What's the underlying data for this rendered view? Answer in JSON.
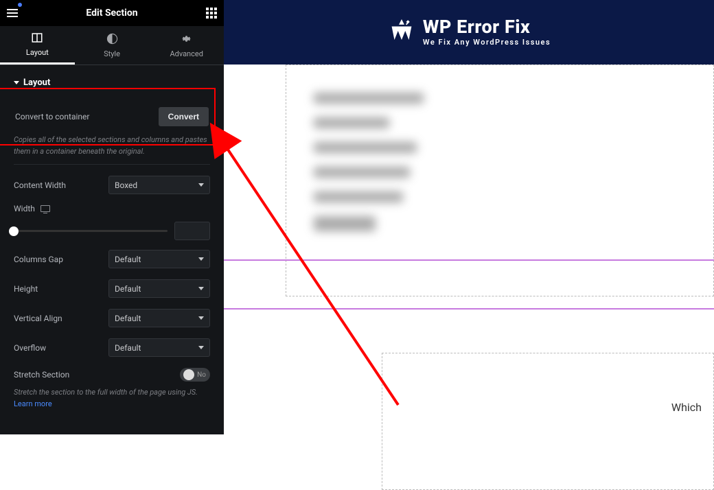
{
  "header": {
    "title": "Edit Section"
  },
  "tabs": {
    "layout": "Layout",
    "style": "Style",
    "advanced": "Advanced"
  },
  "section_title": "Layout",
  "convert": {
    "label": "Convert to container",
    "button": "Convert",
    "help": "Copies all of the selected sections and columns and pastes them in a container beneath the original."
  },
  "content_width": {
    "label": "Content Width",
    "value": "Boxed"
  },
  "width": {
    "label": "Width"
  },
  "columns_gap": {
    "label": "Columns Gap",
    "value": "Default"
  },
  "height": {
    "label": "Height",
    "value": "Default"
  },
  "vertical_align": {
    "label": "Vertical Align",
    "value": "Default"
  },
  "overflow": {
    "label": "Overflow",
    "value": "Default"
  },
  "stretch": {
    "label": "Stretch Section",
    "toggle": "No",
    "help": "Stretch the section to the full width of the page using JS.",
    "link": "Learn more"
  },
  "brand": {
    "name": "WP Error Fix",
    "tagline": "We Fix Any WordPress Issues"
  },
  "canvas": {
    "which": "Which"
  }
}
